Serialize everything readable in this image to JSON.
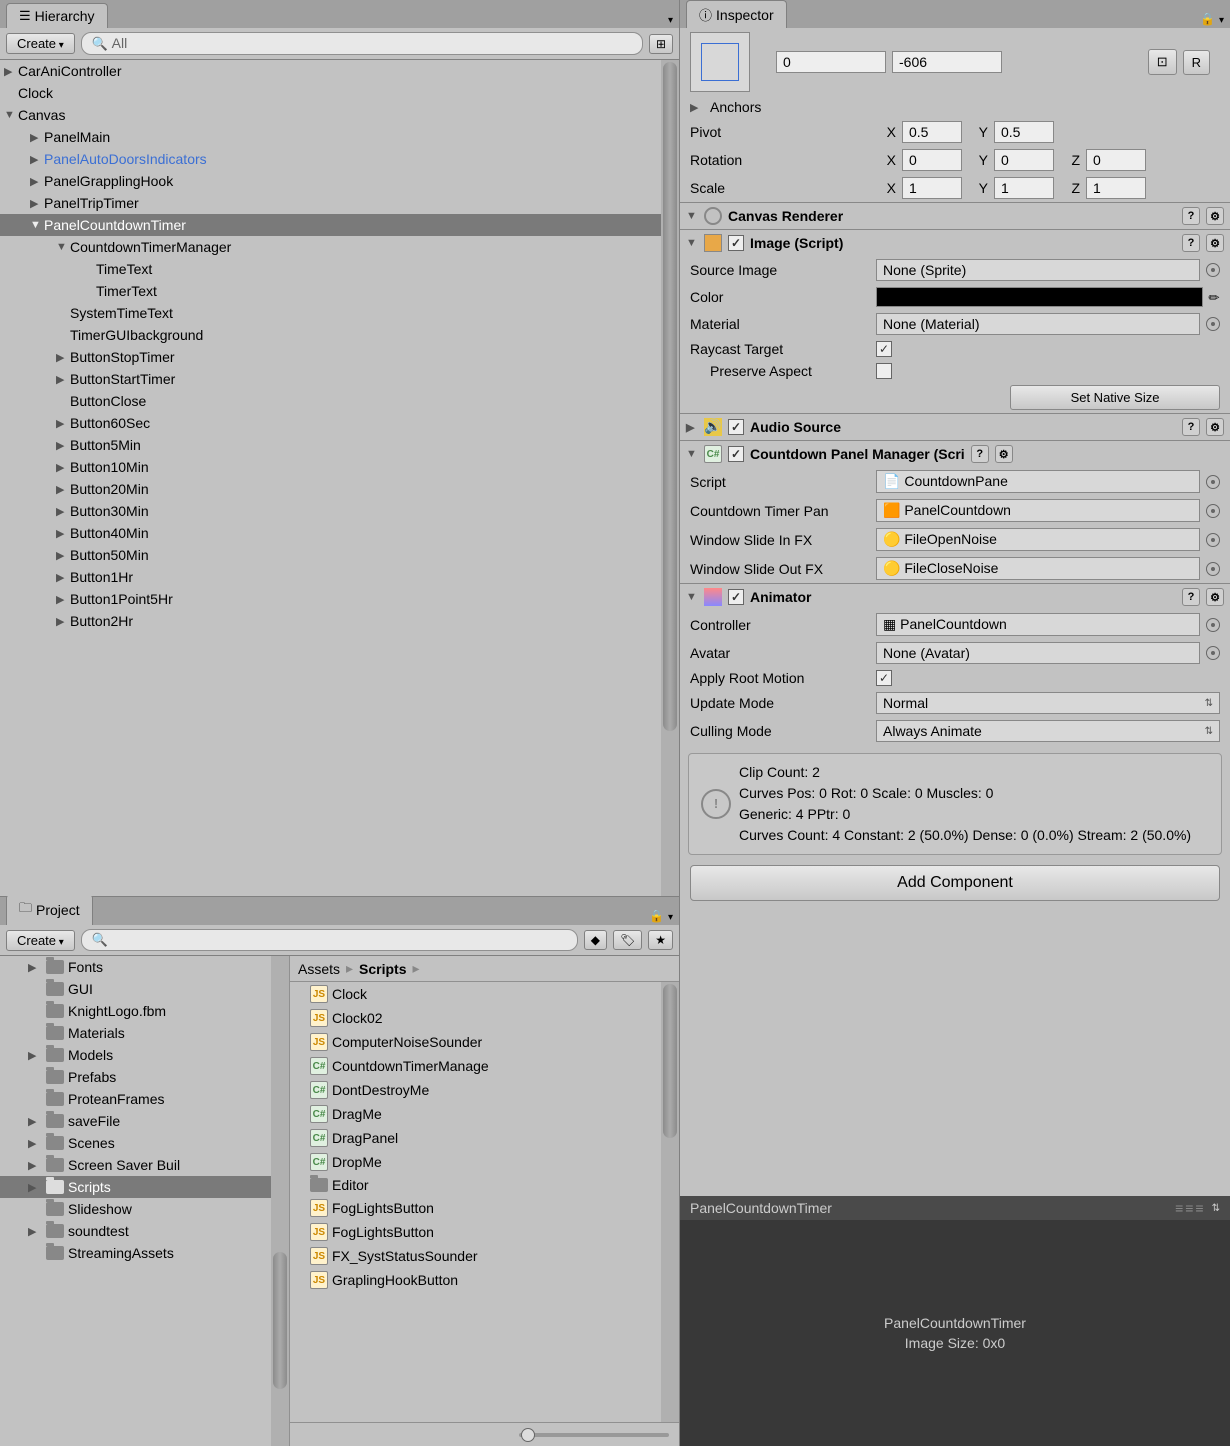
{
  "hierarchy": {
    "title": "Hierarchy",
    "create": "Create",
    "search_placeholder": "All",
    "items": [
      {
        "label": "CarAniController",
        "indent": 0,
        "arrow": "▶"
      },
      {
        "label": "Clock",
        "indent": 0,
        "arrow": ""
      },
      {
        "label": "Canvas",
        "indent": 0,
        "arrow": "▼"
      },
      {
        "label": "PanelMain",
        "indent": 1,
        "arrow": "▶"
      },
      {
        "label": "PanelAutoDoorsIndicators",
        "indent": 1,
        "arrow": "▶",
        "highlight": true
      },
      {
        "label": "PanelGrapplingHook",
        "indent": 1,
        "arrow": "▶"
      },
      {
        "label": "PanelTripTimer",
        "indent": 1,
        "arrow": "▶"
      },
      {
        "label": "PanelCountdownTimer",
        "indent": 1,
        "arrow": "▼",
        "selected": true
      },
      {
        "label": "CountdownTimerManager",
        "indent": 2,
        "arrow": "▼"
      },
      {
        "label": "TimeText",
        "indent": 3,
        "arrow": ""
      },
      {
        "label": "TimerText",
        "indent": 3,
        "arrow": ""
      },
      {
        "label": "SystemTimeText",
        "indent": 2,
        "arrow": ""
      },
      {
        "label": "TimerGUIbackground",
        "indent": 2,
        "arrow": ""
      },
      {
        "label": "ButtonStopTimer",
        "indent": 2,
        "arrow": "▶"
      },
      {
        "label": "ButtonStartTimer",
        "indent": 2,
        "arrow": "▶"
      },
      {
        "label": "ButtonClose",
        "indent": 2,
        "arrow": ""
      },
      {
        "label": "Button60Sec",
        "indent": 2,
        "arrow": "▶"
      },
      {
        "label": "Button5Min",
        "indent": 2,
        "arrow": "▶"
      },
      {
        "label": "Button10Min",
        "indent": 2,
        "arrow": "▶"
      },
      {
        "label": "Button20Min",
        "indent": 2,
        "arrow": "▶"
      },
      {
        "label": "Button30Min",
        "indent": 2,
        "arrow": "▶"
      },
      {
        "label": "Button40Min",
        "indent": 2,
        "arrow": "▶"
      },
      {
        "label": "Button50Min",
        "indent": 2,
        "arrow": "▶"
      },
      {
        "label": "Button1Hr",
        "indent": 2,
        "arrow": "▶"
      },
      {
        "label": "Button1Point5Hr",
        "indent": 2,
        "arrow": "▶"
      },
      {
        "label": "Button2Hr",
        "indent": 2,
        "arrow": "▶"
      }
    ]
  },
  "project": {
    "title": "Project",
    "create": "Create",
    "breadcrumb_assets": "Assets",
    "breadcrumb_scripts": "Scripts",
    "folders": [
      {
        "label": "Fonts",
        "arrow": "▶"
      },
      {
        "label": "GUI",
        "arrow": ""
      },
      {
        "label": "KnightLogo.fbm",
        "arrow": ""
      },
      {
        "label": "Materials",
        "arrow": ""
      },
      {
        "label": "Models",
        "arrow": "▶"
      },
      {
        "label": "Prefabs",
        "arrow": ""
      },
      {
        "label": "ProteanFrames",
        "arrow": ""
      },
      {
        "label": "saveFile",
        "arrow": "▶"
      },
      {
        "label": "Scenes",
        "arrow": "▶"
      },
      {
        "label": "Screen Saver Buil",
        "arrow": "▶"
      },
      {
        "label": "Scripts",
        "arrow": "▶",
        "selected": true
      },
      {
        "label": "Slideshow",
        "arrow": ""
      },
      {
        "label": "soundtest",
        "arrow": "▶"
      },
      {
        "label": "StreamingAssets",
        "arrow": ""
      }
    ],
    "assets": [
      {
        "label": "Clock",
        "type": "js"
      },
      {
        "label": "Clock02",
        "type": "js"
      },
      {
        "label": "ComputerNoiseSounder",
        "type": "js"
      },
      {
        "label": "CountdownTimerManage",
        "type": "cs"
      },
      {
        "label": "DontDestroyMe",
        "type": "cs"
      },
      {
        "label": "DragMe",
        "type": "cs"
      },
      {
        "label": "DragPanel",
        "type": "cs"
      },
      {
        "label": "DropMe",
        "type": "cs"
      },
      {
        "label": "Editor",
        "type": "folder"
      },
      {
        "label": "FogLightsButton",
        "type": "js"
      },
      {
        "label": "FogLightsButton",
        "type": "js"
      },
      {
        "label": "FX_SystStatusSounder",
        "type": "js"
      },
      {
        "label": "GraplingHookButton",
        "type": "js"
      }
    ]
  },
  "inspector": {
    "title": "Inspector",
    "rect": {
      "field1": "0",
      "field2": "-606"
    },
    "anchors_label": "Anchors",
    "pivot_label": "Pivot",
    "pivot_x": "0.5",
    "pivot_y": "0.5",
    "rotation_label": "Rotation",
    "rot_x": "0",
    "rot_y": "0",
    "rot_z": "0",
    "scale_label": "Scale",
    "scale_x": "1",
    "scale_y": "1",
    "scale_z": "1",
    "canvas_renderer": "Canvas Renderer",
    "image_component": "Image (Script)",
    "source_image_label": "Source Image",
    "source_image_val": "None (Sprite)",
    "color_label": "Color",
    "material_label": "Material",
    "material_val": "None (Material)",
    "raycast_label": "Raycast Target",
    "preserve_label": "Preserve Aspect",
    "native_size_btn": "Set Native Size",
    "audio_source": "Audio Source",
    "countdown_mgr": "Countdown Panel Manager (Scri",
    "script_label": "Script",
    "script_val": "CountdownPane",
    "ct_pan_label": "Countdown Timer Pan",
    "ct_pan_val": "PanelCountdown",
    "slide_in_label": "Window Slide In FX",
    "slide_in_val": "FileOpenNoise",
    "slide_out_label": "Window Slide Out FX",
    "slide_out_val": "FileCloseNoise",
    "animator": "Animator",
    "controller_label": "Controller",
    "controller_val": "PanelCountdown",
    "avatar_label": "Avatar",
    "avatar_val": "None (Avatar)",
    "root_motion_label": "Apply Root Motion",
    "update_mode_label": "Update Mode",
    "update_mode_val": "Normal",
    "culling_label": "Culling Mode",
    "culling_val": "Always Animate",
    "info_line1": "Clip Count: 2",
    "info_line2": "Curves Pos: 0 Rot: 0 Scale: 0 Muscles: 0",
    "info_line3": "Generic: 4 PPtr: 0",
    "info_line4": "Curves Count: 4 Constant: 2 (50.0%) Dense: 0 (0.0%) Stream: 2 (50.0%)",
    "add_component": "Add Component",
    "r_btn": "R"
  },
  "preview": {
    "header": "PanelCountdownTimer",
    "name": "PanelCountdownTimer",
    "size": "Image Size: 0x0"
  }
}
